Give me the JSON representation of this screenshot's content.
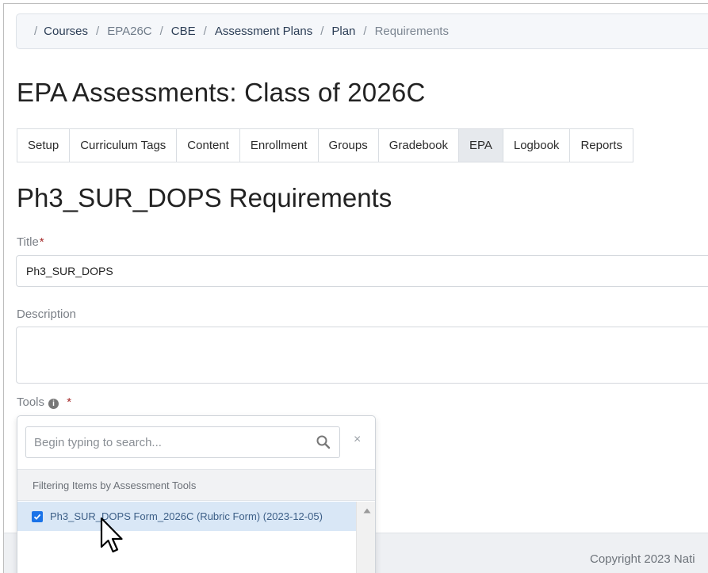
{
  "breadcrumb": {
    "items": [
      "Courses",
      "EPA26C",
      "CBE",
      "Assessment Plans",
      "Plan",
      "Requirements"
    ]
  },
  "page_title": "EPA Assessments: Class of 2026C",
  "tabs": [
    "Setup",
    "Curriculum Tags",
    "Content",
    "Enrollment",
    "Groups",
    "Gradebook",
    "EPA",
    "Logbook",
    "Reports"
  ],
  "active_tab": "EPA",
  "section_title": "Ph3_SUR_DOPS Requirements",
  "form": {
    "title_label": "Title",
    "title_value": "Ph3_SUR_DOPS",
    "description_label": "Description",
    "description_value": "",
    "tools_label": "Tools",
    "required_mark": "*",
    "info_icon": "i"
  },
  "dropdown": {
    "search_placeholder": "Begin typing to search...",
    "clear": "×",
    "filter_header": "Filtering Items by Assessment Tools",
    "items": [
      {
        "label": "Ph3_SUR_DOPS Form_2026C (Rubric Form) (2023-12-05)",
        "checked": true
      }
    ]
  },
  "footer": {
    "copyright": "Copyright 2023 Nati"
  },
  "colors": {
    "checkbox": "#1a73e8",
    "selected_row": "#d9e7f6",
    "required": "#a52a2a"
  }
}
